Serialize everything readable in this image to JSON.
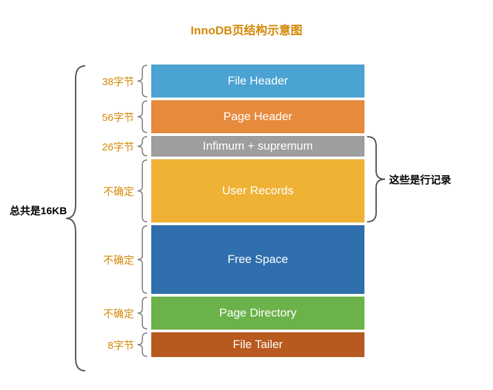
{
  "title": "InnoDB页结构示意图",
  "total_label": "总共是16KB",
  "row_records_label": "这些是行记录",
  "sections": [
    {
      "name": "File Header",
      "size": "38字节",
      "height": 48,
      "color": "#4aa3d3"
    },
    {
      "name": "Page Header",
      "size": "56字节",
      "height": 48,
      "color": "#e78a3c"
    },
    {
      "name": "Infimum + supremum",
      "size": "26字节",
      "height": 30,
      "color": "#9e9e9e"
    },
    {
      "name": "User Records",
      "size": "不确定",
      "height": 92,
      "color": "#efb235"
    },
    {
      "name": "Free Space",
      "size": "不确定",
      "height": 100,
      "color": "#2f6fad"
    },
    {
      "name": "Page Directory",
      "size": "不确定",
      "height": 48,
      "color": "#6bb24a"
    },
    {
      "name": "File Tailer",
      "size": "8字节",
      "height": 36,
      "color": "#b85a1f"
    }
  ],
  "row_records_span": {
    "start_index": 2,
    "end_index": 3
  }
}
